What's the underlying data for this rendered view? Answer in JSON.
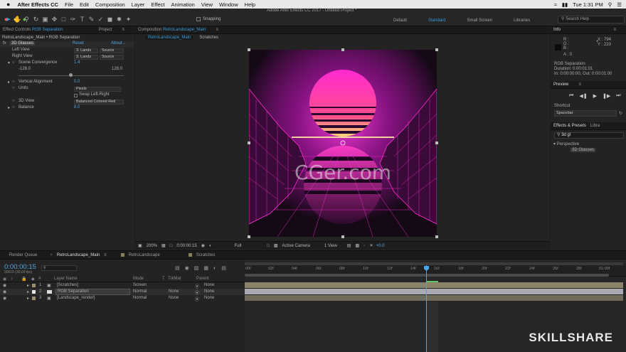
{
  "macbar": {
    "apple": "",
    "menus": [
      "After Effects CC",
      "File",
      "Edit",
      "Composition",
      "Layer",
      "Effect",
      "Animation",
      "View",
      "Window",
      "Help"
    ],
    "clock": "Tue 1:31 PM"
  },
  "toolbar": {
    "app_title": "Adobe After Effects CC 2017 - Untitled Project *",
    "snapping": "Snapping",
    "workspaces": [
      "Default",
      "Standard",
      "Small Screen",
      "Libraries"
    ],
    "active_workspace": "Standard",
    "search_placeholder": "Search Help"
  },
  "effect_controls": {
    "tab_label": "Effect Controls",
    "tab_layer": "RGB Separation",
    "project_tab": "Project",
    "breadcrumb": "RetroLandscape_Main • RGB Separation",
    "effect_name": "3D Glasses",
    "reset": "Reset",
    "about": "About...",
    "props": {
      "left_view": "Left View",
      "left_view_val": "3. Lands",
      "left_view_src": "Source",
      "right_view": "Right View",
      "right_view_val": "3. Lands",
      "right_view_src": "Source",
      "scene_conv": "Scene Convergence",
      "scene_conv_val": "1.4",
      "slider_min": "-128.0",
      "slider_max": "128.0",
      "vert_align": "Vertical Alignment",
      "vert_align_val": "0.0",
      "units": "Units",
      "units_val": "Pixels",
      "swap": "Swap Left-Right",
      "view3d": "3D View",
      "view3d_val": "Balanced Colored Red",
      "balance": "Balance",
      "balance_val": "8.0"
    }
  },
  "composition": {
    "tab_prefix": "Composition",
    "tab_name": "RetroLandscape_Main",
    "subtabs": [
      "RetroLandscape_Main",
      "Scratches"
    ],
    "watermark": "CGer.com",
    "bar": {
      "zoom": "200%",
      "time": "0:00:00:15",
      "resolution": "Full",
      "camera": "Active Camera",
      "views": "1 View",
      "exposure": "+0.0"
    }
  },
  "info": {
    "title": "Info",
    "r": "R :",
    "g": "G :",
    "b": "B :",
    "a": "A : 0",
    "x": "X : 794",
    "y": "Y : 220",
    "layer": "RGB Separation",
    "duration": "Duration: 0:00:01:01",
    "inout": "In: 0:00:00:00, Out: 0:00:01:00"
  },
  "preview": {
    "title": "Preview",
    "shortcut_label": "Shortcut",
    "shortcut_val": "Spacebar"
  },
  "effects_presets": {
    "title": "Effects & Presets",
    "libraries_tab": "Libra",
    "search_val": "3d gl",
    "category": "Perspective",
    "item": "3D Glasses"
  },
  "timeline": {
    "tabs": [
      "Render Queue",
      "RetroLandscape_Main",
      "RetroLandscape",
      "Scratches"
    ],
    "timecode": "0:00:00:15",
    "fps": "00015 (30.00 fps)",
    "col_headers": {
      "num": "#",
      "name": "Layer Name",
      "mode": "Mode",
      "t": "T",
      "trkmat": "TrkMat",
      "parent": "Parent"
    },
    "layers": [
      {
        "num": "1",
        "name": "[Scratches]",
        "mode": "Screen",
        "trkmat": "",
        "parent": "None",
        "color": "#9b8f6c"
      },
      {
        "num": "2",
        "name": "RGB Separation",
        "mode": "Normal",
        "trkmat": "None",
        "parent": "None",
        "color": "#e6e6e6"
      },
      {
        "num": "3",
        "name": "[Landscape_render]",
        "mode": "Normal",
        "trkmat": "None",
        "parent": "None",
        "color": "#9b8f6c"
      }
    ],
    "ruler": [
      "00f",
      "02f",
      "04f",
      "06f",
      "08f",
      "10f",
      "12f",
      "14f",
      "16f",
      "18f",
      "20f",
      "22f",
      "24f",
      "26f",
      "28f",
      "01:00f"
    ]
  },
  "watermark_brand": "SKILLSHARE",
  "colors": {
    "accent_blue": "#3a9bdc",
    "playhead": "#4aa6e8",
    "neon_pink": "#ff2bd6"
  }
}
